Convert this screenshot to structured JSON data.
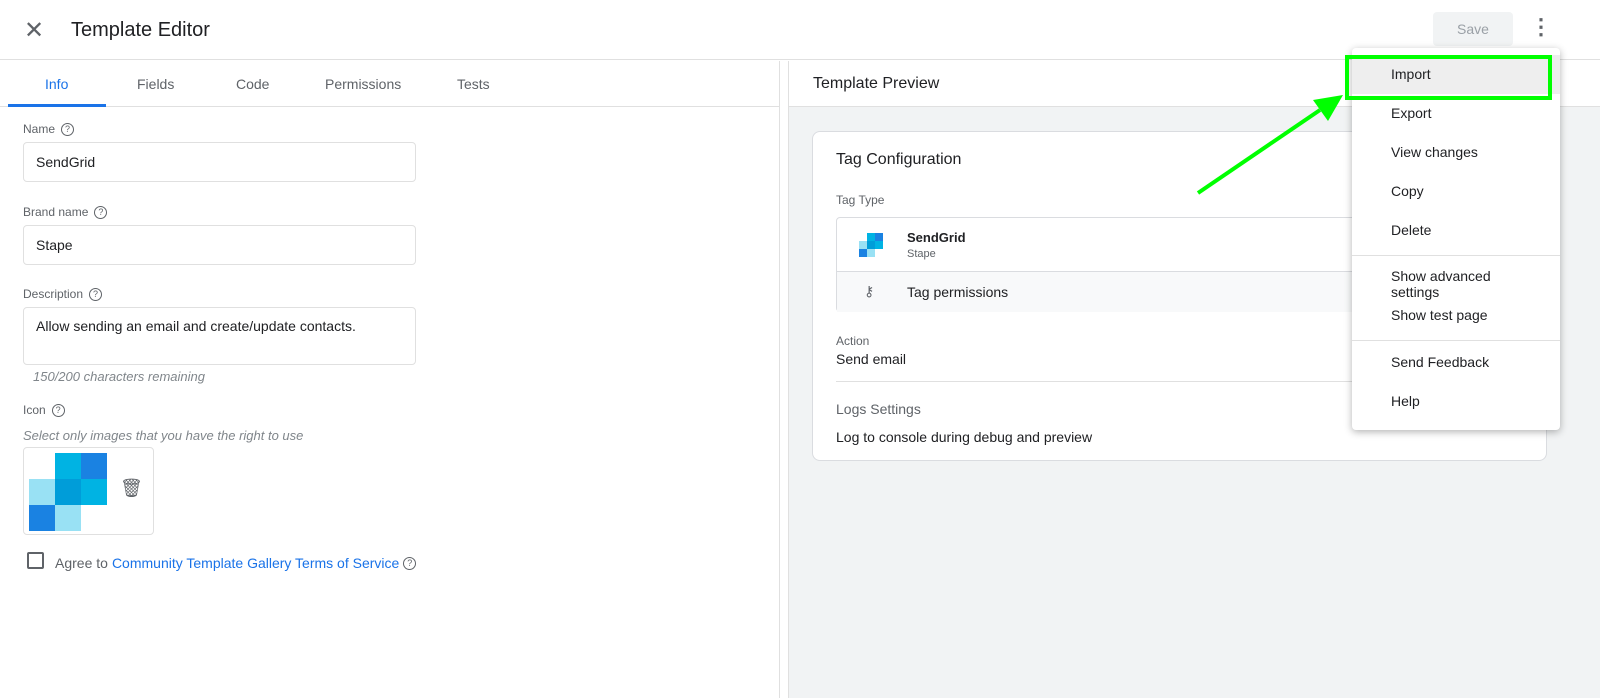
{
  "header": {
    "close_icon": "close-icon",
    "title": "Template Editor",
    "save_label": "Save",
    "more_icon": "more-vert-icon"
  },
  "tabs": [
    {
      "label": "Info",
      "active": true
    },
    {
      "label": "Fields"
    },
    {
      "label": "Code"
    },
    {
      "label": "Permissions"
    },
    {
      "label": "Tests"
    }
  ],
  "info": {
    "name_label": "Name",
    "name_value": "SendGrid",
    "brand_label": "Brand name",
    "brand_value": "Stape",
    "description_label": "Description",
    "description_value": "Allow sending an email and create/update contacts.",
    "chars_remaining": "150/200 characters remaining",
    "icon_label": "Icon",
    "icon_hint": "Select only images that you have the right to use",
    "agree_prefix": "Agree to",
    "agree_link": "Community Template Gallery Terms of Service",
    "agree_checked": false,
    "icon_colors": [
      "#ffffff",
      "#00b3e3",
      "#1a82e2",
      "#99e1f4",
      "#009dd9",
      "#00b3e3",
      "#1a82e2",
      "#99e1f4",
      "#ffffff"
    ]
  },
  "preview": {
    "title": "Template Preview",
    "card_title": "Tag Configuration",
    "tag_type_label": "Tag Type",
    "tag_name": "SendGrid",
    "tag_brand": "Stape",
    "permissions_label": "Tag permissions",
    "action_label": "Action",
    "action_value": "Send email",
    "logs_label": "Logs Settings",
    "logs_value": "Log to console during debug and preview"
  },
  "menu": {
    "items": [
      "Import",
      "Export",
      "View changes",
      "Copy",
      "Delete",
      "Show advanced settings",
      "Show test page",
      "Send Feedback",
      "Help"
    ],
    "highlighted": "Import"
  },
  "annotation": {
    "color": "#00ff00"
  }
}
